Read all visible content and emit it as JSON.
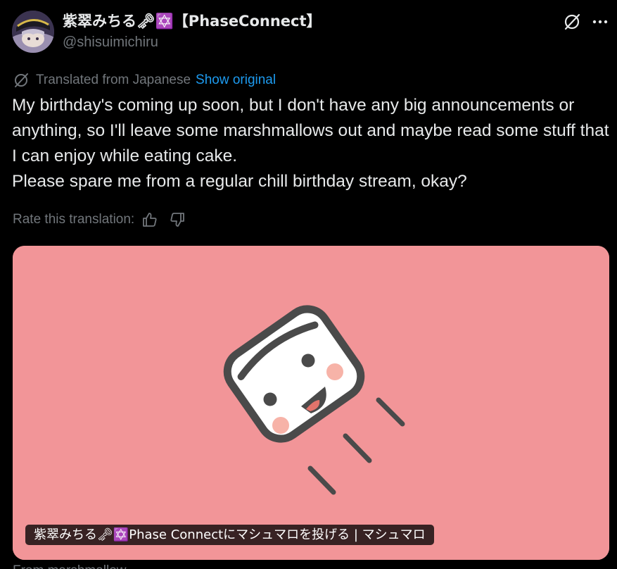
{
  "author": {
    "display_name": "紫翠みちる🗝✡️【PhaseConnect】",
    "handle": "@shisuimichiru"
  },
  "icons": {
    "avatar": "avatar",
    "translate": "no-translate-icon",
    "more": "more-icon",
    "thumbs_up": "thumbs-up-icon",
    "thumbs_down": "thumbs-down-icon"
  },
  "translation": {
    "label": "Translated from Japanese",
    "show_original": "Show original"
  },
  "tweet": {
    "lines": [
      "My birthday's coming up soon, but I don't have any big announcements or anything, so I'll leave some marshmallows out and maybe read some stuff that I can enjoy while eating cake.",
      "Please spare me from a regular chill birthday stream, okay?"
    ]
  },
  "rating": {
    "label": "Rate this translation:"
  },
  "card": {
    "caption": "紫翠みちる🗝✡️Phase Connectにマシュマロを投げる | マシュマロ",
    "background_color": "#f29598"
  },
  "footer": {
    "partial_text": "From marshmallow..."
  },
  "colors": {
    "background": "#000000",
    "text": "#e7e9ea",
    "muted": "#71767b",
    "link": "#1d9bf0"
  }
}
